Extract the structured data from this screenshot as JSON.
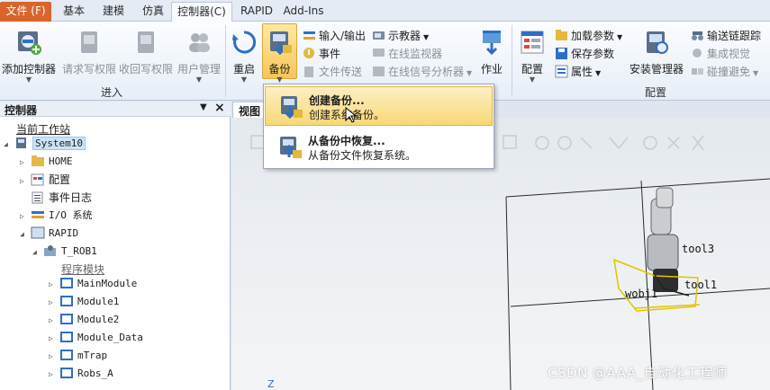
{
  "tabs": [
    {
      "label": "文件 (F)"
    },
    {
      "label": "基本"
    },
    {
      "label": "建模"
    },
    {
      "label": "仿真"
    },
    {
      "label": "控制器(C)"
    },
    {
      "label": "RAPID"
    },
    {
      "label": "Add-Ins"
    }
  ],
  "ribbon": {
    "add_controller": "添加控制器",
    "request_write": "请求写权限",
    "revoke_write": "收回写权限",
    "user_mgmt": "用户管理",
    "group_input": "进入",
    "restart": "重启",
    "backup": "备份",
    "io": "输入/输出",
    "event": "事件",
    "file_transfer": "文件传送",
    "teach_pendant": "示教器",
    "online_monitor": "在线监视器",
    "online_signal": "在线信号分析器",
    "job": "作业",
    "config": "配置",
    "load_params": "加载参数",
    "save_params": "保存参数",
    "properties": "属性",
    "install_mgr": "安装管理器",
    "group_config": "配置",
    "transfer_trace": "输送链跟踪",
    "integrated_vision": "集成视觉",
    "collision_avoid": "碰撞避免"
  },
  "dropdown": {
    "create_title": "创建备份...",
    "create_desc": "创建系统备份。",
    "restore_title": "从备份中恢复...",
    "restore_desc": "从备份文件恢复系统。"
  },
  "panel": {
    "title": "控制器",
    "pin": "▼",
    "close": "×",
    "station": "当前工作站",
    "program_modules": "程序模块"
  },
  "tree": [
    {
      "label": "System10"
    },
    {
      "label": "HOME"
    },
    {
      "label": "配置"
    },
    {
      "label": "事件日志"
    },
    {
      "label": "I/O 系统"
    },
    {
      "label": "RAPID"
    },
    {
      "label": "T_ROB1"
    },
    {
      "label": "MainModule"
    },
    {
      "label": "Module1"
    },
    {
      "label": "Module2"
    },
    {
      "label": "Module_Data"
    },
    {
      "label": "mTrap"
    },
    {
      "label": "Robs_A"
    }
  ],
  "view": {
    "tab": "视图",
    "labels": {
      "tool3": "tool3",
      "tool1": "tool1",
      "wobj": "wobj1",
      "axis": "Z"
    }
  },
  "watermark": "CSDN @AAA_自动化工程师",
  "colors": {
    "file_tab": "#d9652a",
    "highlight": "#f7d878",
    "selection": "#cce4f7"
  }
}
